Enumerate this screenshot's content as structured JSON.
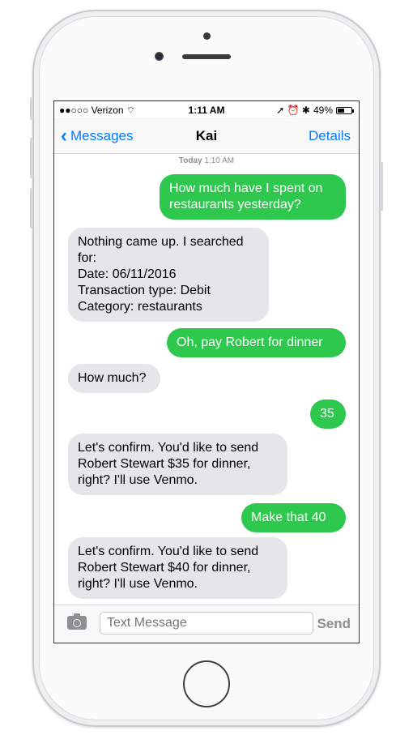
{
  "status": {
    "carrier": "●●○○○ Verizon ⌔",
    "time": "1:11 AM",
    "icons": "➚ ⏰ ✱",
    "battery": "49%",
    "battery_level": 0.49
  },
  "nav": {
    "back_label": "Messages",
    "title": "Kai",
    "details_label": "Details"
  },
  "stamp": {
    "day": "Today",
    "time": "1:10 AM"
  },
  "messages": [
    {
      "dir": "out",
      "text": "How much have I spent on restaurants yesterday?"
    },
    {
      "dir": "in",
      "text": "Nothing came up. I searched for:\nDate: 06/11/2016\nTransaction type: Debit\nCategory: restaurants"
    },
    {
      "dir": "out",
      "text": "Oh, pay Robert for dinner"
    },
    {
      "dir": "in",
      "text": "How much?"
    },
    {
      "dir": "out",
      "text": "35"
    },
    {
      "dir": "in",
      "text": "Let's confirm. You'd like to send Robert Stewart $35 for dinner, right? I'll use Venmo."
    },
    {
      "dir": "out",
      "text": "Make that 40"
    },
    {
      "dir": "in",
      "text": "Let's confirm. You'd like to send Robert Stewart $40 for dinner, right? I'll use Venmo."
    }
  ],
  "input": {
    "placeholder": "Text Message",
    "send_label": "Send"
  },
  "colors": {
    "outgoing": "#2dc84d",
    "incoming": "#e5e5ea",
    "accent": "#0a7aff"
  }
}
